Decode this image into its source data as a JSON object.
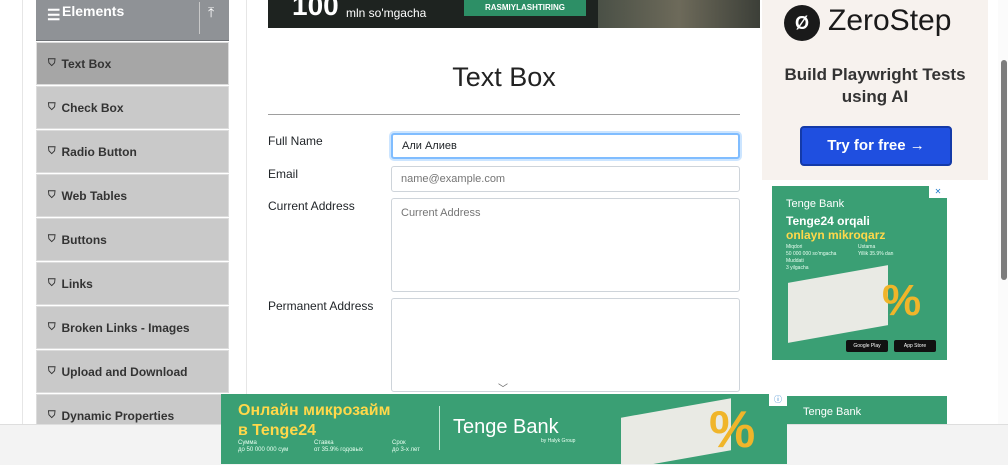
{
  "sidebar": {
    "group_title": "Elements",
    "hamburger": "☰",
    "collapse_icon": "⤒",
    "items": [
      {
        "label": "Text Box"
      },
      {
        "label": "Check Box"
      },
      {
        "label": "Radio Button"
      },
      {
        "label": "Web Tables"
      },
      {
        "label": "Buttons"
      },
      {
        "label": "Links"
      },
      {
        "label": "Broken Links - Images"
      },
      {
        "label": "Upload and Download"
      },
      {
        "label": "Dynamic Properties"
      }
    ],
    "active_item": "Text Box"
  },
  "top_banner": {
    "big_text": "100",
    "small_text": "mln so'mgacha",
    "button_text": "RASMIYLASHTIRING"
  },
  "main": {
    "title": "Text Box",
    "form": {
      "full_name_label": "Full Name",
      "full_name_value": "Али Алиев",
      "email_label": "Email",
      "email_placeholder": "name@example.com",
      "current_address_label": "Current Address",
      "current_address_placeholder": "Current Address",
      "permanent_address_label": "Permanent Address"
    }
  },
  "ads": {
    "zerostep": {
      "logo_glyph": "Ø",
      "name": "ZeroStep",
      "tagline": "Build Playwright Tests using AI",
      "button": "Try for free →"
    },
    "tenge_side": {
      "brand": "Tenge Bank",
      "headline_1": "Tenge24 orqali",
      "headline_2": "onlayn mikroqarz",
      "detail_1": "Miqdori",
      "detail_2": "50 000 000 so'mgacha",
      "detail_3": "Ustama",
      "detail_4": "Yillik 35.9% dan",
      "detail_5": "Muddati",
      "detail_6": "3 yilgacha",
      "percent": "%",
      "store_1": "Google Play",
      "store_2": "App Store"
    },
    "tenge_side_2": {
      "brand": "Tenge Bank"
    },
    "tenge_bottom": {
      "line_1": "Онлайн микрозайм",
      "line_2": "в Tenge24",
      "sum_label": "Сумма",
      "sum_value": "до 50 000 000 сум",
      "rate_label": "Ставка",
      "rate_value": "от 35.9% годовых",
      "term_label": "Срок",
      "term_value": "до 3-х лет",
      "logo": "Tenge Bank",
      "logo_sub": "by Halyk Group",
      "percent": "%"
    },
    "ad_close": "✕",
    "ad_info": "ⓘ"
  }
}
